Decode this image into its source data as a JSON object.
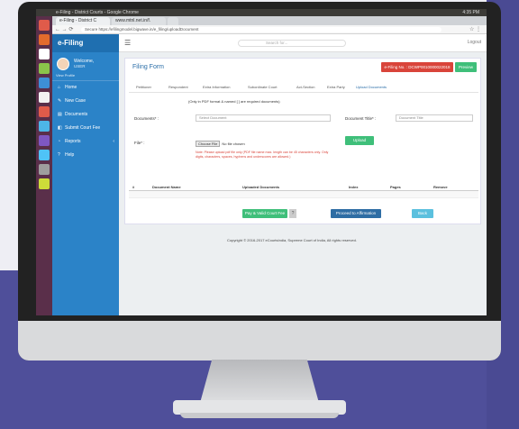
{
  "os": {
    "window_title": "e-Filing - District Courts - Google Chrome",
    "status": "4:35 PM"
  },
  "browser": {
    "tabs": [
      "e-Filing - District C",
      "www.mtnl.net.in/f.",
      ""
    ],
    "nav": "← → ⟳",
    "url": "Secure  https://efilingmodel.bigwave.in/e_filing/uploadDocument",
    "menu": "☆ ⋮"
  },
  "app": {
    "brand": "e-Filing",
    "user": {
      "welcome": "Welcome,",
      "name": "USER",
      "profile": "View Profile"
    },
    "nav": [
      {
        "icon": "home-icon",
        "glyph": "⌂",
        "label": "Home"
      },
      {
        "icon": "new-case-icon",
        "glyph": "✎",
        "label": "New Case"
      },
      {
        "icon": "documents-icon",
        "glyph": "▤",
        "label": "Documents"
      },
      {
        "icon": "draft-icon",
        "glyph": "◧",
        "label": "Submit Court Fee"
      },
      {
        "icon": "reports-icon",
        "glyph": "◔",
        "label": "Reports",
        "chevron": "‹"
      },
      {
        "icon": "help-icon",
        "glyph": "?",
        "label": "Help"
      }
    ],
    "topbar": {
      "search_placeholder": "Search for...",
      "logout": "Logout"
    },
    "page_title": "Filing Form",
    "case_number": "e-Filing No. : DCWP0010000022018",
    "preview_label": "Preview",
    "subtabs": [
      "Petitioner",
      "Respondent",
      "Extra Information",
      "Subordinate Court",
      "Act-Section",
      "Extra Party",
      "Upload Documents"
    ],
    "note": "(Only in PDF format & named [ ] are required documents)",
    "documents_label": "Documents* :",
    "documents_select": "Select Document",
    "doc_title_label": "Document Title* :",
    "doc_title_placeholder": "Document Title",
    "file_label": "File* :",
    "choose_btn": "Choose File",
    "no_file": "No file chosen",
    "warning": "Note: Please upload pdf file only (PDF file name max. length can be 45 characters only. Only digits, characters, spaces, hyphens and underscores are allowed.)",
    "upload_btn": "Upload",
    "table_headers": [
      "#",
      "Document Name",
      "Uploaded Documents",
      "Index",
      "Pages",
      "Remove"
    ],
    "pay_btn": "Pay & Valid Court Fee",
    "proceed_btn": "Proceed to Affirmation",
    "back_btn": "Back",
    "footer": "Copyright © 2016-2017 eCourtsIndia, Supreme Court of India, All rights reserved."
  },
  "colors": {
    "sidebar": "#2b83c8",
    "accent_red": "#d9443a",
    "accent_green": "#3fbf7a",
    "accent_blue": "#2e6da4"
  }
}
